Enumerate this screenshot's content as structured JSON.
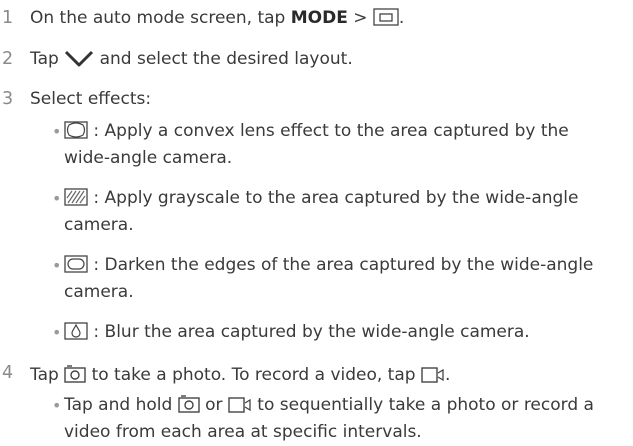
{
  "steps": [
    {
      "num": "1",
      "pre": "On the auto mode screen, tap ",
      "bold": "MODE",
      "sep": " > ",
      "post": "."
    },
    {
      "num": "2",
      "pre": "Tap ",
      "post": " and select the desired layout."
    },
    {
      "num": "3",
      "text": "Select effects:"
    },
    {
      "num": "4",
      "pre": "Tap ",
      "mid": " to take a photo. To record a video, tap ",
      "post": "."
    }
  ],
  "effects": [
    {
      "icon": "convex-lens-icon",
      "line1": " : Apply a convex lens effect to the area captured by the",
      "line2": "wide-angle camera."
    },
    {
      "icon": "grayscale-icon",
      "line1": " : Apply grayscale to the area captured by the wide-angle",
      "line2": "camera."
    },
    {
      "icon": "vignette-icon",
      "line1": " : Darken the edges of the area captured by the wide-angle",
      "line2": "camera."
    },
    {
      "icon": "blur-icon",
      "line1": " : Blur the area captured by the wide-angle camera."
    }
  ],
  "tip": {
    "pre": "Tap and hold ",
    "mid": " or ",
    "post": " to sequentially take a photo or record a",
    "line2": "video from each area at specific intervals."
  },
  "icons": {
    "mode_layout": "layout-icon",
    "dropdown": "chevron-down-icon",
    "photo": "camera-icon",
    "video": "video-icon"
  },
  "colors": {
    "text": "#3a3a3a",
    "number": "#8a8a8a",
    "bullet": "#9a9a9a"
  }
}
